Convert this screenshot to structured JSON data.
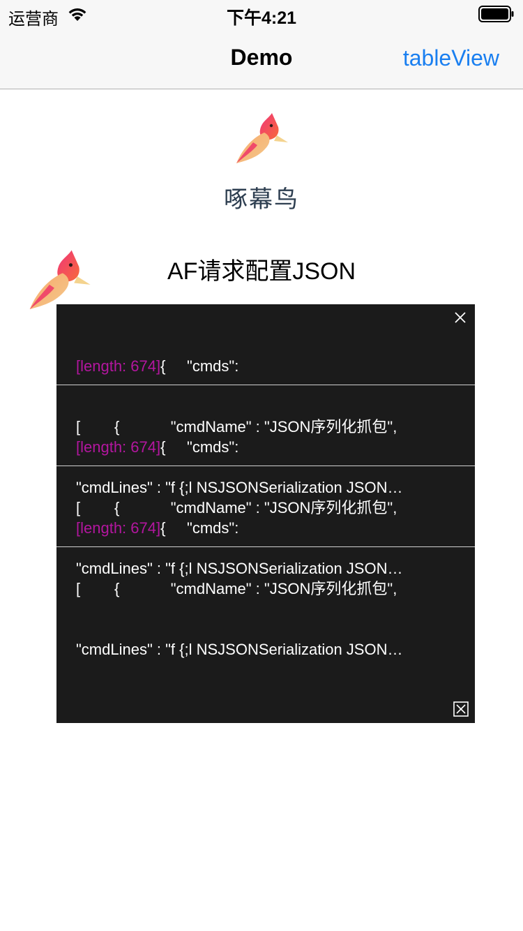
{
  "status_bar": {
    "carrier": "运营商",
    "time": "下午4:21",
    "wifi_icon": "wifi-icon",
    "battery_icon": "battery-icon"
  },
  "nav": {
    "title": "Demo",
    "right_button": "tableView"
  },
  "header": {
    "app_name": "啄幕鸟",
    "section_title": "AF请求配置JSON",
    "logo_icon": "woodpecker-logo-icon"
  },
  "log_panel": {
    "items": [
      {
        "tag": "[length: 674]",
        "line1": "{     \"cmds\":",
        "line2": "[        {            \"cmdName\" : \"JSON序列化抓包\",",
        "line3": "\"cmdLines\" : \"f {;l NSJSONSerialization JSON…"
      },
      {
        "tag": "[length: 674]",
        "line1": "{     \"cmds\":",
        "line2": "[        {            \"cmdName\" : \"JSON序列化抓包\",",
        "line3": "\"cmdLines\" : \"f {;l NSJSONSerialization JSON…"
      },
      {
        "tag": "[length: 674]",
        "line1": "{     \"cmds\":",
        "line2": "[        {            \"cmdName\" : \"JSON序列化抓包\",",
        "line3": "\"cmdLines\" : \"f {;l NSJSONSerialization JSON…"
      }
    ],
    "close_icon": "close-icon",
    "clear_icon": "clear-box-icon"
  },
  "colors": {
    "accent": "#1a7ff0",
    "panel_bg": "#1b1b1b",
    "tag": "#b3169f",
    "app_name": "#2d3e50"
  }
}
